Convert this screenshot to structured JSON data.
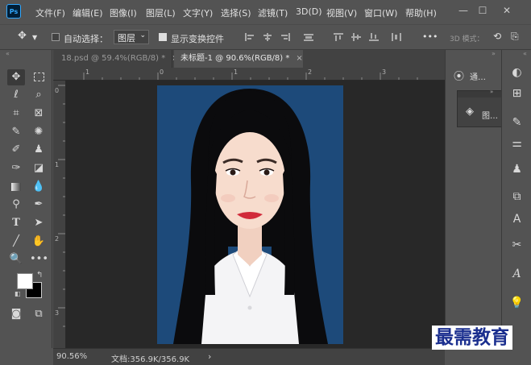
{
  "app": {
    "logo_text": "Ps"
  },
  "menu": [
    "文件(F)",
    "编辑(E)",
    "图像(I)",
    "图层(L)",
    "文字(Y)",
    "选择(S)",
    "滤镜(T)",
    "3D(D)",
    "视图(V)",
    "窗口(W)",
    "帮助(H)"
  ],
  "options_bar": {
    "auto_select_label": "自动选择：",
    "auto_select_checked": false,
    "target_value": "图层",
    "show_transform_label": "显示变换控件",
    "show_transform_checked": true,
    "more": "•••",
    "mode_3d": "3D 模式：",
    "toolbar_toggle": "«"
  },
  "tabs": [
    {
      "label": "18.psd @ 59.4%(RGB/8) *",
      "close": "×",
      "active": false
    },
    {
      "label": "未标题-1 @ 90.6%(RGB/8) *",
      "close": "×",
      "active": true
    }
  ],
  "rulers": {
    "top": [
      "1",
      "0",
      "1",
      "2",
      "3"
    ],
    "left": [
      "0",
      "1",
      "2",
      "3"
    ]
  },
  "toolbox": {
    "tools": [
      "move-tool",
      "marquee-tool",
      "lasso-tool",
      "quick-select-tool",
      "crop-tool",
      "frame-tool",
      "eyedropper-tool",
      "spot-heal-tool",
      "brush-tool",
      "clone-stamp-tool",
      "history-brush-tool",
      "eraser-tool",
      "gradient-tool",
      "blur-tool",
      "dodge-tool",
      "pen-tool",
      "type-tool",
      "path-select-tool",
      "line-tool",
      "hand-tool",
      "zoom-tool",
      "more-tools"
    ],
    "foreground_color": "#ffffff",
    "background_color": "#000000"
  },
  "panels": {
    "channels_label": "通…",
    "layers_label": "图…"
  },
  "status": {
    "zoom": "90.56%",
    "doc": "文档:356.9K/356.9K",
    "arrow": "›"
  },
  "watermark": "最需教育",
  "colors": {
    "background_blue": "#1d4a7a",
    "ui_gray": "#535353",
    "canvas_dark": "#282828"
  }
}
